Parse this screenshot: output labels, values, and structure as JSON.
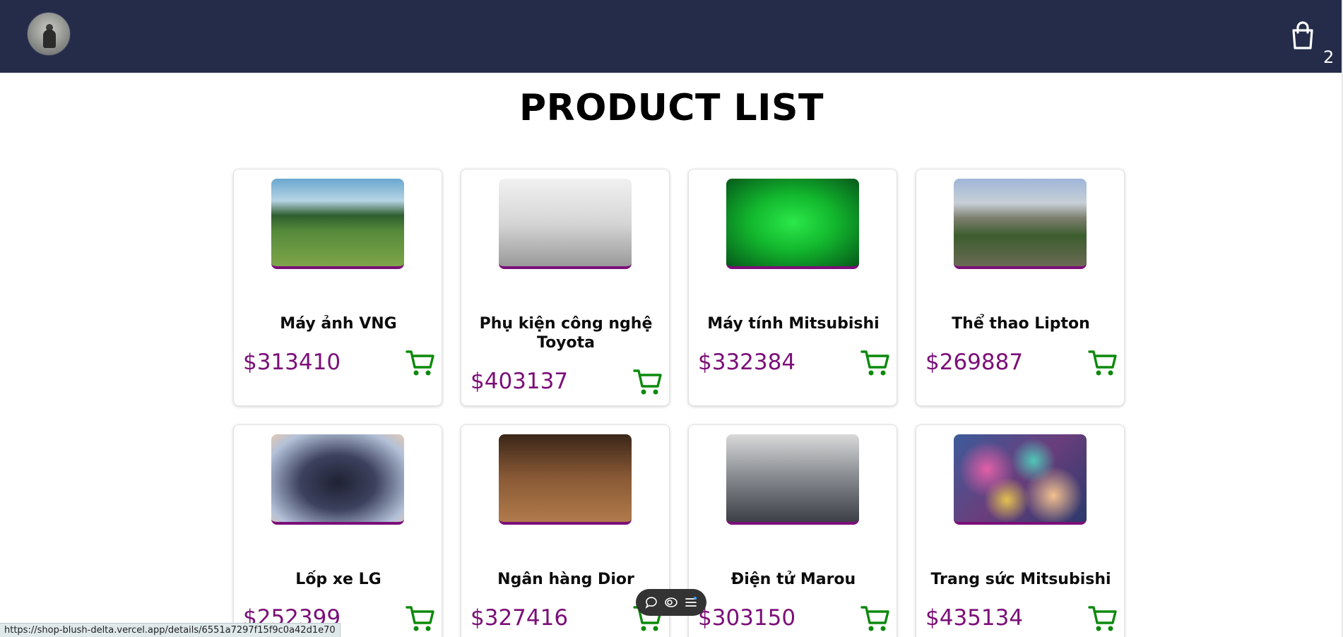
{
  "header": {
    "cart_count": "2",
    "icons": {
      "avatar": "avatar",
      "cart": "shopping-bag-icon"
    }
  },
  "page": {
    "title": "PRODUCT LIST"
  },
  "products": [
    {
      "name": "Máy ảnh VNG",
      "price": "$313410",
      "image": "path-landscape"
    },
    {
      "name": "Phụ kiện công nghệ Toyota",
      "price": "$403137",
      "image": "statue-of-liberty"
    },
    {
      "name": "Máy tính Mitsubishi",
      "price": "$332384",
      "image": "green-leaf-droplet"
    },
    {
      "name": "Thể thao Lipton",
      "price": "$269887",
      "image": "mountain-forest"
    },
    {
      "name": "Lốp xe LG",
      "price": "$252399",
      "image": "grapes-in-hands"
    },
    {
      "name": "Ngân hàng Dior",
      "price": "$327416",
      "image": "laptop-on-desk"
    },
    {
      "name": "Điện tử Marou",
      "price": "$303150",
      "image": "skyscraper"
    },
    {
      "name": "Trang sức Mitsubishi",
      "price": "$435134",
      "image": "bokeh-lights"
    }
  ],
  "status_bar": {
    "url": "https://shop-blush-delta.vercel.app/details/6551a7297f15f9c0a42d1e70"
  },
  "colors": {
    "navbar": "#252c49",
    "price": "#7b0f78",
    "cart_icon": "#0c8a0c"
  }
}
